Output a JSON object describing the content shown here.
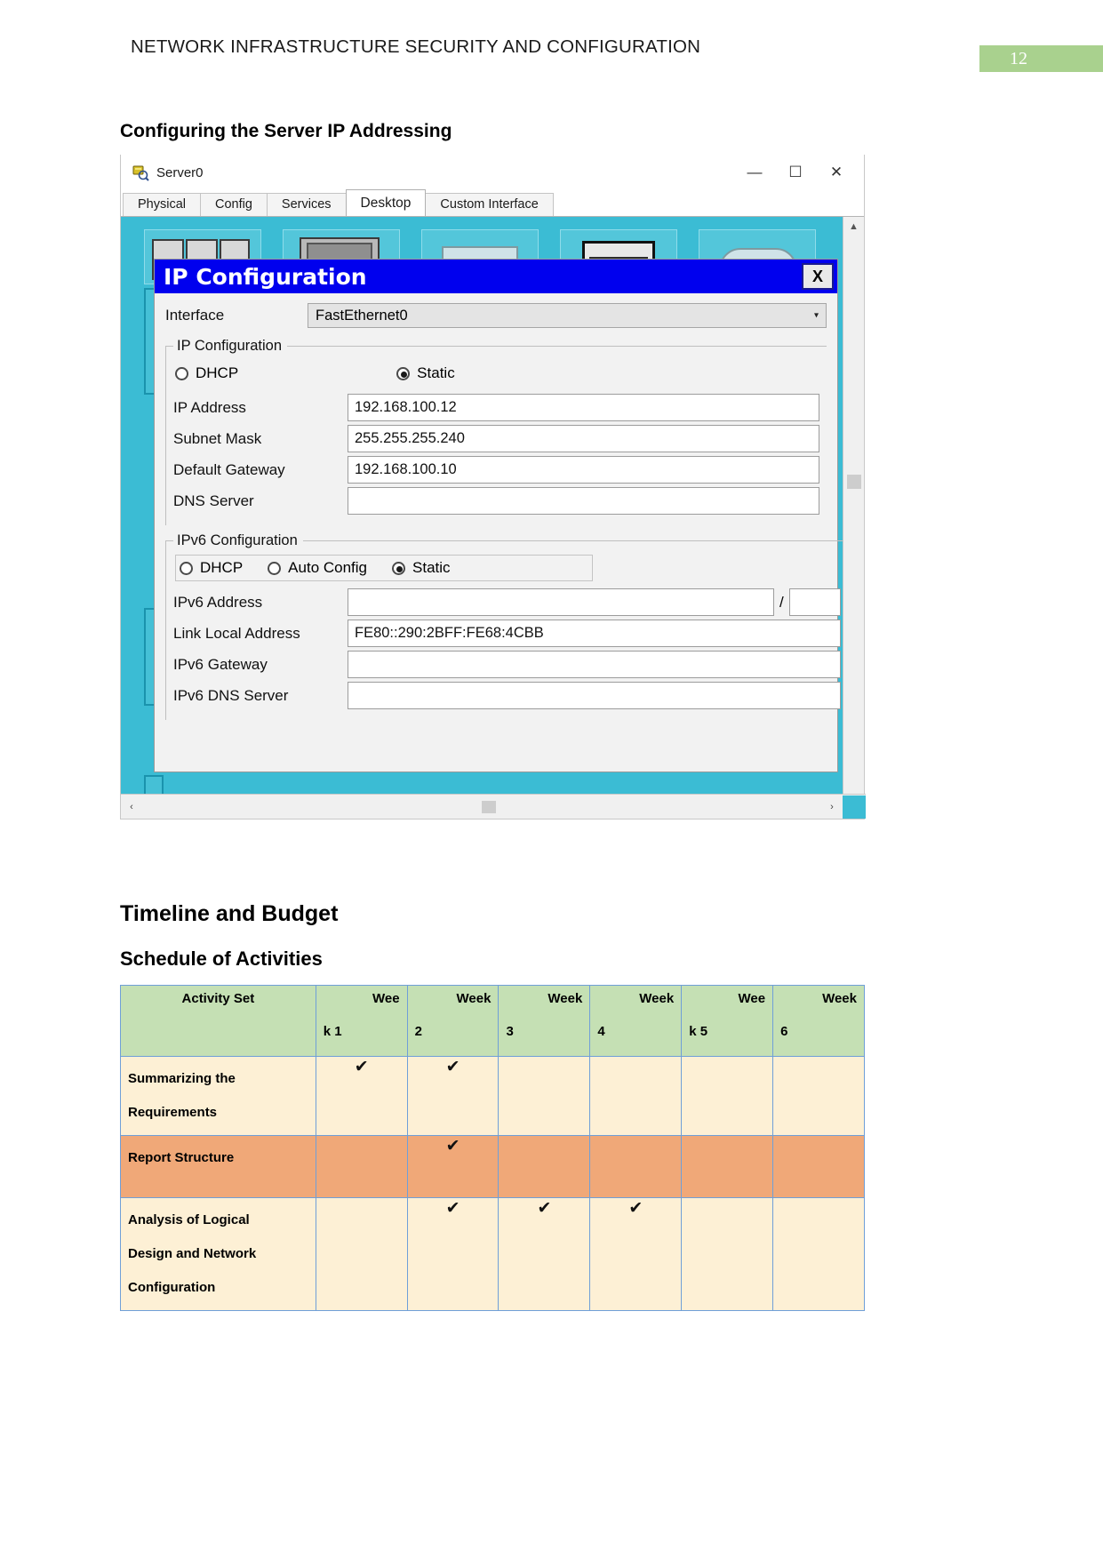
{
  "page": {
    "running_title": "NETWORK INFRASTRUCTURE SECURITY AND CONFIGURATION",
    "page_number": "12",
    "accent_green": "#a9d18e"
  },
  "headings": {
    "configuring": "Configuring the Server IP Addressing",
    "timeline": "Timeline and Budget",
    "schedule": "Schedule of Activities"
  },
  "pt_window": {
    "title": "Server0",
    "icon": "server-icon",
    "window_buttons": {
      "minimize": "—",
      "maximize": "☐",
      "close": "✕"
    },
    "tabs": [
      {
        "label": "Physical",
        "active": false
      },
      {
        "label": "Config",
        "active": false
      },
      {
        "label": "Services",
        "active": false
      },
      {
        "label": "Desktop",
        "active": true
      },
      {
        "label": "Custom Interface",
        "active": false
      }
    ],
    "scroll": {
      "up_arrow": "▲",
      "down_arrow": "▼",
      "left_arrow": "‹",
      "right_arrow": "›"
    }
  },
  "ip_config": {
    "title": "IP Configuration",
    "close_label": "X",
    "interface_label": "Interface",
    "interface_value": "FastEthernet0",
    "combo_caret": "▾",
    "ipv4": {
      "legend": "IP Configuration",
      "dhcp_label": "DHCP",
      "dhcp_selected": false,
      "static_label": "Static",
      "static_selected": true,
      "fields": [
        {
          "label": "IP Address",
          "value": "192.168.100.12"
        },
        {
          "label": "Subnet Mask",
          "value": "255.255.255.240"
        },
        {
          "label": "Default Gateway",
          "value": "192.168.100.10"
        },
        {
          "label": "DNS Server",
          "value": ""
        }
      ]
    },
    "ipv6": {
      "legend": "IPv6 Configuration",
      "dhcp_label": "DHCP",
      "dhcp_selected": false,
      "auto_label": "Auto Config",
      "auto_selected": false,
      "static_label": "Static",
      "static_selected": true,
      "address_label": "IPv6 Address",
      "address_value": "",
      "prefix_separator": "/",
      "prefix_value": "",
      "fields": [
        {
          "label": "Link Local Address",
          "value": "FE80::290:2BFF:FE68:4CBB"
        },
        {
          "label": "IPv6 Gateway",
          "value": ""
        },
        {
          "label": "IPv6 DNS Server",
          "value": ""
        }
      ]
    }
  },
  "schedule": {
    "columns": [
      {
        "top": "Activity Set",
        "bottom": ""
      },
      {
        "top": "Wee",
        "bottom": "k 1"
      },
      {
        "top": "Week",
        "bottom": "2"
      },
      {
        "top": "Week",
        "bottom": "3"
      },
      {
        "top": "Week",
        "bottom": "4"
      },
      {
        "top": "Wee",
        "bottom": "k 5"
      },
      {
        "top": "Week",
        "bottom": "6"
      }
    ],
    "check_mark": "✔",
    "rows": [
      {
        "activity": "Summarizing the\nRequirements",
        "activity_lines": [
          "Summarizing the",
          "Requirements"
        ],
        "highlight": false,
        "marks": [
          true,
          true,
          false,
          false,
          false,
          false
        ]
      },
      {
        "activity": "Report Structure",
        "activity_lines": [
          "Report Structure"
        ],
        "highlight": true,
        "marks": [
          false,
          true,
          false,
          false,
          false,
          false
        ]
      },
      {
        "activity": "Analysis of Logical Design and Network Configuration",
        "activity_lines": [
          "Analysis of Logical",
          "Design and Network",
          "Configuration"
        ],
        "highlight": false,
        "marks": [
          false,
          true,
          true,
          true,
          false,
          false
        ]
      }
    ]
  }
}
